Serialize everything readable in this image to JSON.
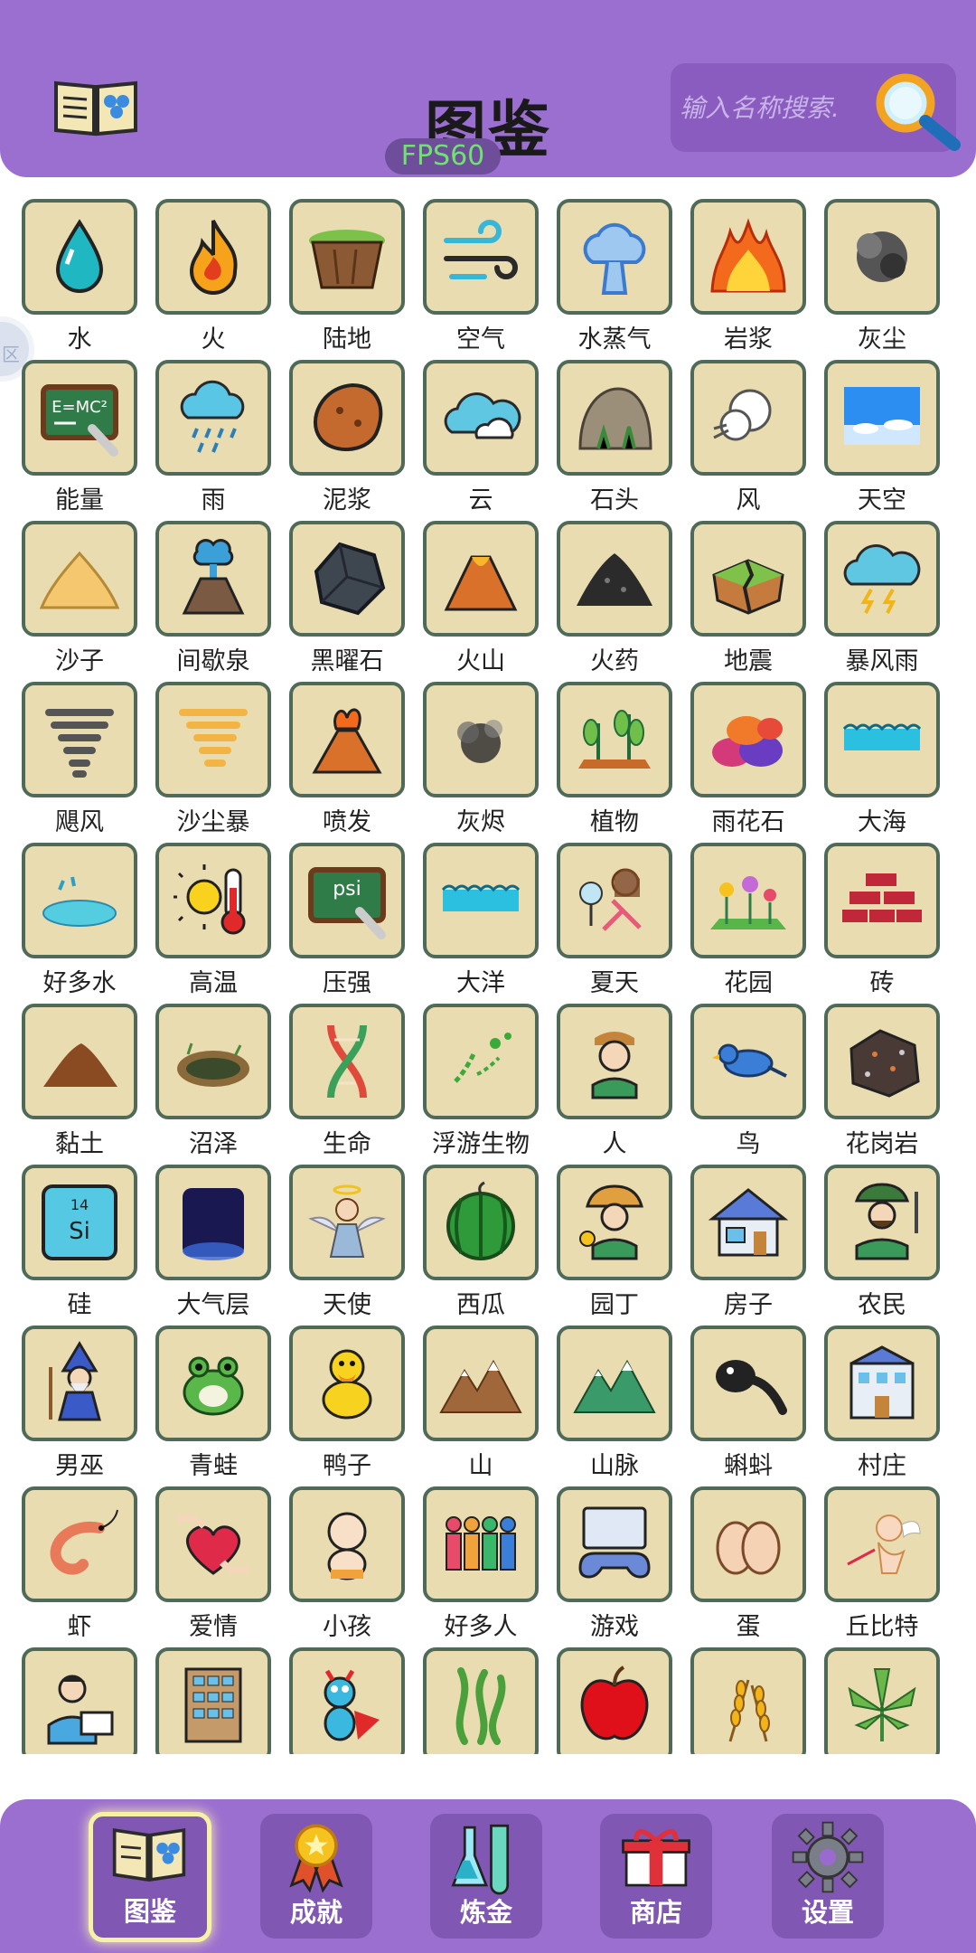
{
  "header": {
    "title": "图鉴",
    "fps": "FPS60",
    "search_placeholder": "输入名称搜索."
  },
  "side_handle": "区",
  "items": [
    {
      "label": "水",
      "icon": "water-drop-icon"
    },
    {
      "label": "火",
      "icon": "fire-icon"
    },
    {
      "label": "陆地",
      "icon": "land-icon"
    },
    {
      "label": "空气",
      "icon": "air-icon"
    },
    {
      "label": "水蒸气",
      "icon": "steam-icon"
    },
    {
      "label": "岩浆",
      "icon": "lava-icon"
    },
    {
      "label": "灰尘",
      "icon": "dust-icon"
    },
    {
      "label": "能量",
      "icon": "energy-icon"
    },
    {
      "label": "雨",
      "icon": "rain-icon"
    },
    {
      "label": "泥浆",
      "icon": "mud-icon"
    },
    {
      "label": "云",
      "icon": "cloud-icon"
    },
    {
      "label": "石头",
      "icon": "stone-icon"
    },
    {
      "label": "风",
      "icon": "wind-icon"
    },
    {
      "label": "天空",
      "icon": "sky-icon"
    },
    {
      "label": "沙子",
      "icon": "sand-icon"
    },
    {
      "label": "间歇泉",
      "icon": "geyser-icon"
    },
    {
      "label": "黑曜石",
      "icon": "obsidian-icon"
    },
    {
      "label": "火山",
      "icon": "volcano-icon"
    },
    {
      "label": "火药",
      "icon": "gunpowder-icon"
    },
    {
      "label": "地震",
      "icon": "earthquake-icon"
    },
    {
      "label": "暴风雨",
      "icon": "storm-icon"
    },
    {
      "label": "飓风",
      "icon": "hurricane-icon"
    },
    {
      "label": "沙尘暴",
      "icon": "sandstorm-icon"
    },
    {
      "label": "喷发",
      "icon": "eruption-icon"
    },
    {
      "label": "灰烬",
      "icon": "ash-icon"
    },
    {
      "label": "植物",
      "icon": "plant-icon"
    },
    {
      "label": "雨花石",
      "icon": "pebbles-icon"
    },
    {
      "label": "大海",
      "icon": "sea-icon"
    },
    {
      "label": "好多水",
      "icon": "puddle-icon"
    },
    {
      "label": "高温",
      "icon": "heat-icon"
    },
    {
      "label": "压强",
      "icon": "pressure-icon"
    },
    {
      "label": "大洋",
      "icon": "ocean-icon"
    },
    {
      "label": "夏天",
      "icon": "summer-icon"
    },
    {
      "label": "花园",
      "icon": "garden-icon"
    },
    {
      "label": "砖",
      "icon": "brick-icon"
    },
    {
      "label": "黏土",
      "icon": "clay-icon"
    },
    {
      "label": "沼泽",
      "icon": "swamp-icon"
    },
    {
      "label": "生命",
      "icon": "dna-icon"
    },
    {
      "label": "浮游生物",
      "icon": "plankton-icon"
    },
    {
      "label": "人",
      "icon": "human-icon"
    },
    {
      "label": "鸟",
      "icon": "bird-icon"
    },
    {
      "label": "花岗岩",
      "icon": "granite-icon"
    },
    {
      "label": "硅",
      "icon": "silicon-icon"
    },
    {
      "label": "大气层",
      "icon": "atmosphere-icon"
    },
    {
      "label": "天使",
      "icon": "angel-icon"
    },
    {
      "label": "西瓜",
      "icon": "watermelon-icon"
    },
    {
      "label": "园丁",
      "icon": "gardener-icon"
    },
    {
      "label": "房子",
      "icon": "house-icon"
    },
    {
      "label": "农民",
      "icon": "farmer-icon"
    },
    {
      "label": "男巫",
      "icon": "wizard-icon"
    },
    {
      "label": "青蛙",
      "icon": "frog-icon"
    },
    {
      "label": "鸭子",
      "icon": "duck-icon"
    },
    {
      "label": "山",
      "icon": "mountain-icon"
    },
    {
      "label": "山脉",
      "icon": "mountain-range-icon"
    },
    {
      "label": "蝌蚪",
      "icon": "tadpole-icon"
    },
    {
      "label": "村庄",
      "icon": "village-icon"
    },
    {
      "label": "虾",
      "icon": "shrimp-icon"
    },
    {
      "label": "爱情",
      "icon": "love-icon"
    },
    {
      "label": "小孩",
      "icon": "baby-icon"
    },
    {
      "label": "好多人",
      "icon": "crowd-icon"
    },
    {
      "label": "游戏",
      "icon": "game-icon"
    },
    {
      "label": "蛋",
      "icon": "egg-icon"
    },
    {
      "label": "丘比特",
      "icon": "cupid-icon"
    },
    {
      "label": "",
      "icon": "computer-user-icon"
    },
    {
      "label": "",
      "icon": "building-icon"
    },
    {
      "label": "",
      "icon": "toy-icon"
    },
    {
      "label": "",
      "icon": "seaweed-icon"
    },
    {
      "label": "",
      "icon": "apple-icon"
    },
    {
      "label": "",
      "icon": "wheat-icon"
    },
    {
      "label": "",
      "icon": "leaf-icon"
    }
  ],
  "nav": [
    {
      "label": "图鉴",
      "icon": "book-icon",
      "active": true
    },
    {
      "label": "成就",
      "icon": "medal-icon",
      "active": false
    },
    {
      "label": "炼金",
      "icon": "flask-icon",
      "active": false
    },
    {
      "label": "商店",
      "icon": "gift-icon",
      "active": false
    },
    {
      "label": "设置",
      "icon": "gear-icon",
      "active": false
    }
  ],
  "colors": {
    "header_bg": "#9b6fd0",
    "tile_bg": "#e9dcb0",
    "tile_border": "#506a5a",
    "fps_text": "#6ee36e"
  }
}
